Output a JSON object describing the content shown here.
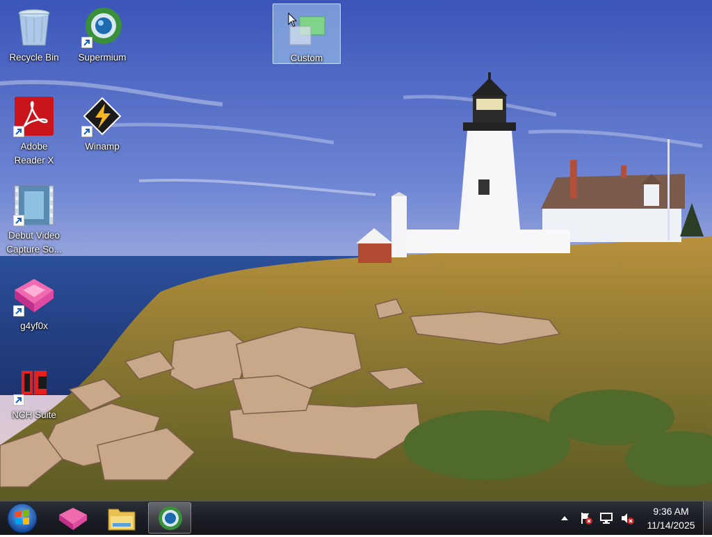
{
  "desktop": {
    "icons": [
      {
        "label": "Recycle Bin",
        "icon": "recycle-bin-icon"
      },
      {
        "label": "Supermium",
        "icon": "supermium-icon"
      },
      {
        "label": "Custom",
        "icon": "custom-icon",
        "selected": true
      },
      {
        "label": "Adobe Reader X",
        "icon": "adobe-reader-icon"
      },
      {
        "label": "Winamp",
        "icon": "winamp-icon"
      },
      {
        "label": "Debut Video Capture So...",
        "icon": "debut-video-icon"
      },
      {
        "label": "g4yf0x",
        "icon": "g4yf0x-icon"
      },
      {
        "label": "NCH Suite",
        "icon": "nch-suite-icon"
      }
    ]
  },
  "taskbar": {
    "pinned": [
      {
        "name": "g4yf0x",
        "icon": "g4yf0x-icon"
      },
      {
        "name": "Windows Explorer",
        "icon": "folder-icon"
      },
      {
        "name": "Supermium",
        "icon": "supermium-icon",
        "active": true
      }
    ],
    "tray": {
      "icons": [
        "show-hidden-icons-arrow",
        "action-center-flag-icon",
        "network-icon",
        "volume-muted-icon"
      ]
    },
    "clock": {
      "time": "9:36 AM",
      "date": "11/14/2025"
    }
  },
  "colors": {
    "taskbar": "#1c1f26",
    "selection": "#aacdf0"
  }
}
